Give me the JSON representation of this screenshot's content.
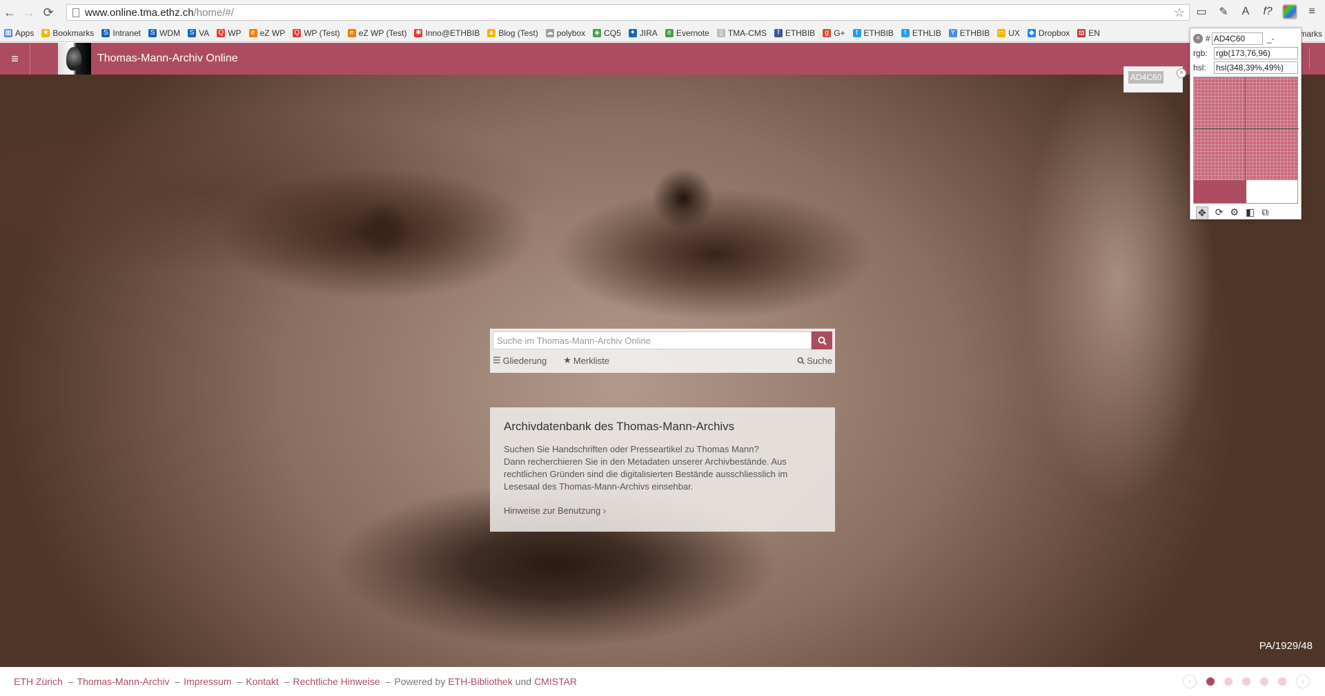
{
  "browser": {
    "url_host": "www.online.tma.ethz.ch",
    "url_path": "/home/#/",
    "bookmarks": [
      {
        "label": "Apps",
        "color": "#4a8af4",
        "glyph": "▦"
      },
      {
        "label": "Bookmarks",
        "color": "#f6b400",
        "glyph": "★"
      },
      {
        "label": "Intranet",
        "color": "#1565c0",
        "glyph": "S"
      },
      {
        "label": "WDM",
        "color": "#1565c0",
        "glyph": "S"
      },
      {
        "label": "VA",
        "color": "#1565c0",
        "glyph": "S"
      },
      {
        "label": "WP",
        "color": "#e53935",
        "glyph": "Q"
      },
      {
        "label": "eZ WP",
        "color": "#f57c00",
        "glyph": "e"
      },
      {
        "label": "WP (Test)",
        "color": "#e53935",
        "glyph": "Q"
      },
      {
        "label": "eZ WP (Test)",
        "color": "#f57c00",
        "glyph": "e"
      },
      {
        "label": "Inno@ETHBIB",
        "color": "#e53935",
        "glyph": "✱"
      },
      {
        "label": "Blog (Test)",
        "color": "#f6b400",
        "glyph": "▲"
      },
      {
        "label": "polybox",
        "color": "#9e9e9e",
        "glyph": "☁"
      },
      {
        "label": "CQ5",
        "color": "#43a047",
        "glyph": "◈"
      },
      {
        "label": "JIRA",
        "color": "#1565c0",
        "glyph": "✦"
      },
      {
        "label": "Evernote",
        "color": "#43a047",
        "glyph": "e"
      },
      {
        "label": "TMA-CMS",
        "color": "#bdbdbd",
        "glyph": "▯"
      },
      {
        "label": "ETHBIB",
        "color": "#3b5998",
        "glyph": "f"
      },
      {
        "label": "G+",
        "color": "#dd4b39",
        "glyph": "g"
      },
      {
        "label": "ETHBIB",
        "color": "#1da1f2",
        "glyph": "t"
      },
      {
        "label": "ETHLIB",
        "color": "#1da1f2",
        "glyph": "t"
      },
      {
        "label": "ETHBIB",
        "color": "#4a8af4",
        "glyph": "Y"
      },
      {
        "label": "UX",
        "color": "#f6b400",
        "glyph": "▭"
      },
      {
        "label": "Dropbox",
        "color": "#1e88e5",
        "glyph": "◆"
      },
      {
        "label": "EN",
        "color": "#c62828",
        "glyph": "▤"
      }
    ],
    "bookmarks_overflow": "marks"
  },
  "header": {
    "title": "Thomas-Mann-Archiv Online",
    "accent_color": "#ad4c60"
  },
  "search": {
    "placeholder": "Suche im Thomas-Mann-Archiv Online",
    "links": {
      "outline": "Gliederung",
      "watchlist": "Merkliste",
      "search": "Suche"
    }
  },
  "info": {
    "title": "Archivdatenbank des Thomas-Mann-Archivs",
    "line1": "Suchen Sie Handschriften oder Presseartikel zu Thomas Mann?",
    "line2": "Dann recherchieren Sie in den Metadaten unserer Archivbestände. Aus rechtlichen Gründen sind die digitalisierten Bestände ausschliesslich im Lesesaal des Thomas-Mann-Archivs einsehbar.",
    "link": "Hinweise zur Benutzung ›"
  },
  "hero": {
    "credit": "PA/1929/48"
  },
  "footer": {
    "eth": "ETH Zürich",
    "tma": "Thomas-Mann-Archiv",
    "impressum": "Impressum",
    "kontakt": "Kontakt",
    "legal": "Rechtliche Hinweise",
    "powered_by": "Powered by",
    "ethbib": "ETH-Bibliothek",
    "und": "und",
    "cmistar": "CMISTAR",
    "separator": "–",
    "active_slide": 1,
    "slide_count": 5
  },
  "colorpicker": {
    "hex_float": "AD4C60",
    "hex_prefix": "#",
    "hex": "AD4C60",
    "rgb_label": "rgb:",
    "rgb": "rgb(173,76,96)",
    "hsl_label": "hsl:",
    "hsl": "hsl(348,39%,49%)",
    "minimize": "_-"
  }
}
